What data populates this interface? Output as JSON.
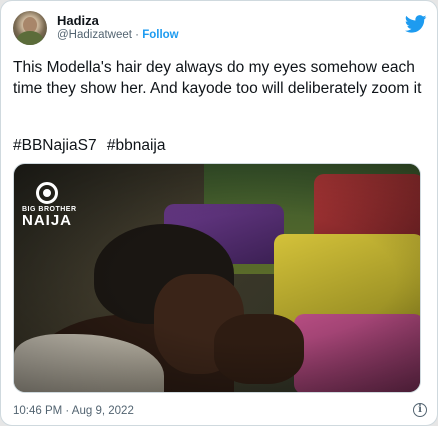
{
  "tweet": {
    "author": {
      "name": "Hadiza",
      "handle": "@Hadizatweet",
      "separator": "·",
      "follow_label": "Follow"
    },
    "body": "This Modella's hair dey always do my eyes somehow each time they show her. And kayode too will deliberately zoom it",
    "hashtags": [
      "#BBNajiaS7",
      "#bbnaija"
    ],
    "media": {
      "logo_small": "BIG BROTHER",
      "logo_big": "NAIJA"
    },
    "timestamp": "10:46 PM · Aug 9, 2022",
    "info_glyph": "i"
  },
  "icons": {
    "platform": "twitter-bird-icon",
    "info": "info-icon"
  },
  "colors": {
    "link": "#1d9bf0",
    "secondary_text": "#536471",
    "primary_text": "#0f1419",
    "border": "#cfd9de"
  }
}
